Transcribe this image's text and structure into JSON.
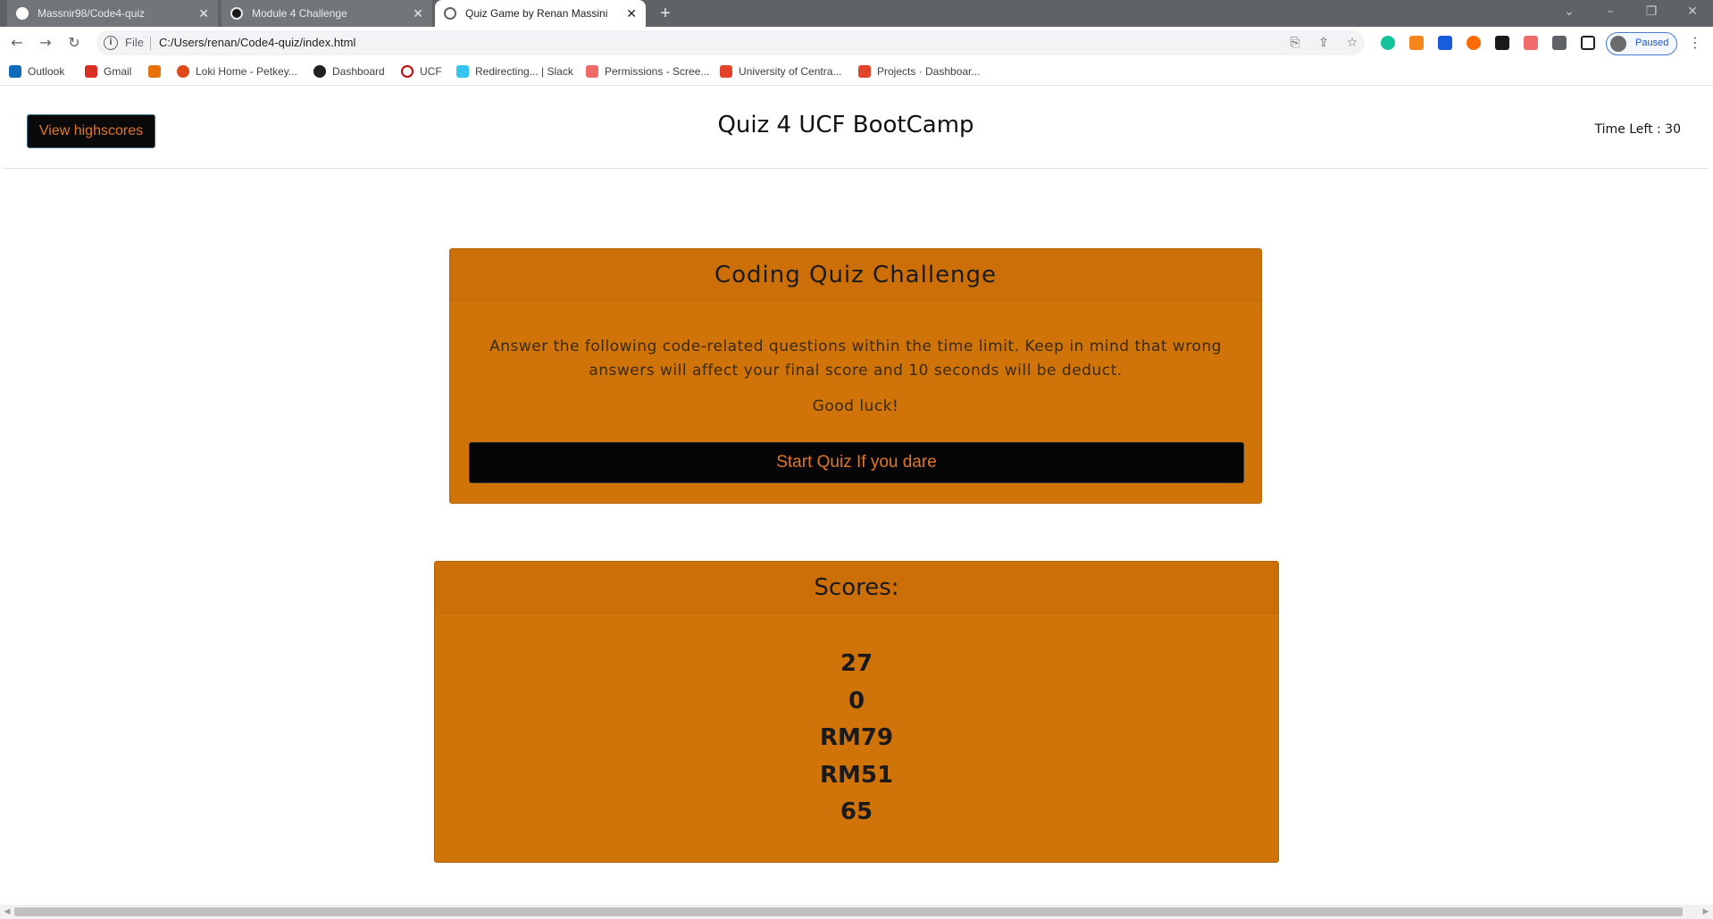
{
  "browser": {
    "tabs": [
      {
        "title": "Massnir98/Code4-quiz",
        "active": false
      },
      {
        "title": "Module 4 Challenge",
        "active": false
      },
      {
        "title": "Quiz Game by Renan Massini",
        "active": true
      }
    ],
    "new_tab_label": "+",
    "close_glyph": "✕",
    "address": {
      "scheme_label": "File",
      "url": "C:/Users/renan/Code4-quiz/index.html"
    },
    "profile_label": "Paused",
    "bookmarks": [
      {
        "label": "Outlook",
        "icon": "outlook-icon",
        "color": "#0f6cbd"
      },
      {
        "label": "Gmail",
        "icon": "gmail-icon",
        "color": "#d93025"
      },
      {
        "label": "",
        "icon": "dashboard-grid-icon",
        "color": "#e8710a"
      },
      {
        "label": "Loki Home - Petkey...",
        "icon": "loki-icon",
        "color": "#e04a1a"
      },
      {
        "label": "Dashboard",
        "icon": "dashboard-icon",
        "color": "#202124"
      },
      {
        "label": "UCF",
        "icon": "ucf-icon",
        "color": "#c5050c"
      },
      {
        "label": "Redirecting... | Slack",
        "icon": "slack-icon",
        "color": "#4a154b"
      },
      {
        "label": "Permissions - Scree...",
        "icon": "permissions-icon",
        "color": "#f06a6a"
      },
      {
        "label": "University of Centra...",
        "icon": "gitlab-icon",
        "color": "#e24329"
      },
      {
        "label": "Projects · Dashboar...",
        "icon": "gitlab-icon",
        "color": "#e24329"
      }
    ]
  },
  "header": {
    "highscores_button": "View highscores",
    "title": "Quiz 4 UCF BootCamp",
    "timer_text": "Time Left : 30"
  },
  "quiz": {
    "title": "Coding Quiz Challenge",
    "description": "Answer the following code-related questions within the time limit. Keep in mind that wrong answers will affect your final score and 10 seconds will be deduct.",
    "good_luck": "Good luck!",
    "start_button": "Start Quiz If you dare"
  },
  "scores": {
    "title": "Scores:",
    "items": [
      "27",
      "0",
      "RM79",
      "RM51",
      "65"
    ]
  },
  "colors": {
    "accent_orange": "#d07308",
    "button_text_orange": "#e0762a",
    "button_bg": "#0a0a0a"
  }
}
